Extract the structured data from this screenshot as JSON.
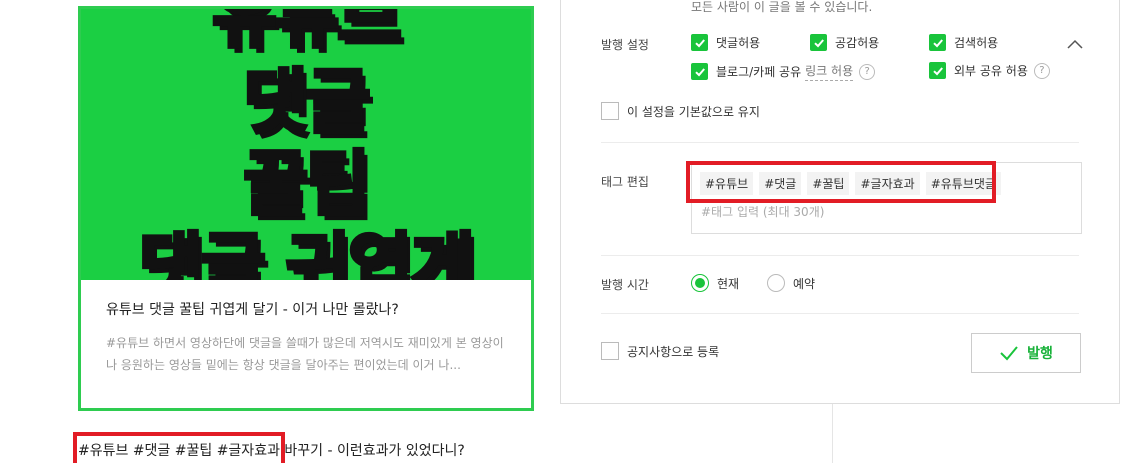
{
  "preview": {
    "thumbnail_lines": [
      "유튜브",
      "댓글",
      "꿀팁",
      "댓글 귀엽게"
    ],
    "title": "유튜브 댓글 꿀팁 귀엽게 달기 - 이거 나만 몰랐나?",
    "description": "#유튜브 하면서 영상하단에 댓글을 쓸때가 많은데 저역시도 재미있게 본 영상이나 응원하는 영상들 밑에는 항상 댓글을 달아주는 편이었는데 이거 나..."
  },
  "post_title_line": "#유튜브 #댓글 #꿀팁 #글자효과 바꾸기 - 이런효과가 있었다니?",
  "publish": {
    "visibility_note": "모든 사람이 이 글을 볼 수 있습니다.",
    "settings_label": "발행 설정",
    "options": {
      "comments": "댓글허용",
      "likes": "공감허용",
      "search": "검색허용",
      "blog_cafe_share": "블로그/카페 공유",
      "link_allow": "링크 허용",
      "external_share": "외부 공유 허용"
    },
    "keep_default_label": "이 설정을 기본값으로 유지",
    "tag_label": "태그 편집",
    "tags": [
      "#유튜브",
      "#댓글",
      "#꿀팁",
      "#글자효과",
      "#유튜브댓글"
    ],
    "tag_placeholder": "#태그 입력 (최대 30개)",
    "time_label": "발행 시간",
    "time_now": "현재",
    "time_reserve": "예약",
    "notice_label": "공지사항으로 등록",
    "publish_button": "발행",
    "help_glyph": "?"
  },
  "colors": {
    "accent": "#19c43b",
    "highlight": "#e21c25",
    "thumb_bg": "#1bcf43",
    "thumb_text": "#f1e61a"
  }
}
